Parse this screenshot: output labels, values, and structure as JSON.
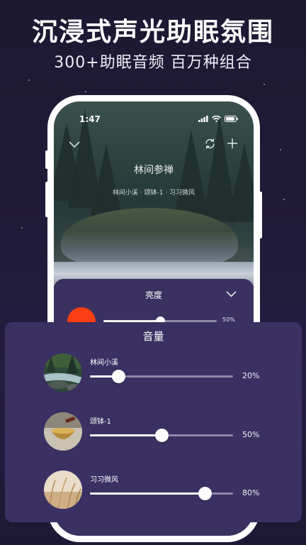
{
  "promo": {
    "headline": "沉浸式声光助眠氛围",
    "subheadline": "300+助眠音频 百万种组合"
  },
  "status_bar": {
    "time": "1:47",
    "icons": [
      "signal-icon",
      "wifi-icon",
      "battery-icon"
    ]
  },
  "player": {
    "title": "林间参禅",
    "subtitle": "林间小溪 · 颂钵-1 · 习习微风",
    "icons": [
      "chevron-down-icon",
      "refresh-icon",
      "plus-icon"
    ]
  },
  "brightness": {
    "title": "亮度",
    "value_label": "50%",
    "level": 0.5,
    "swatch_color": "#fb3e13"
  },
  "volume": {
    "title": "音量",
    "sounds": [
      {
        "name": "林间小溪",
        "value_label": "20%",
        "level": 0.2
      },
      {
        "name": "颂钵-1",
        "value_label": "50%",
        "level": 0.5
      },
      {
        "name": "习习微风",
        "value_label": "80%",
        "level": 0.8
      }
    ]
  },
  "colors": {
    "background": "#211b3a",
    "panel": "#3a3062",
    "accent": "#fb3e13"
  }
}
